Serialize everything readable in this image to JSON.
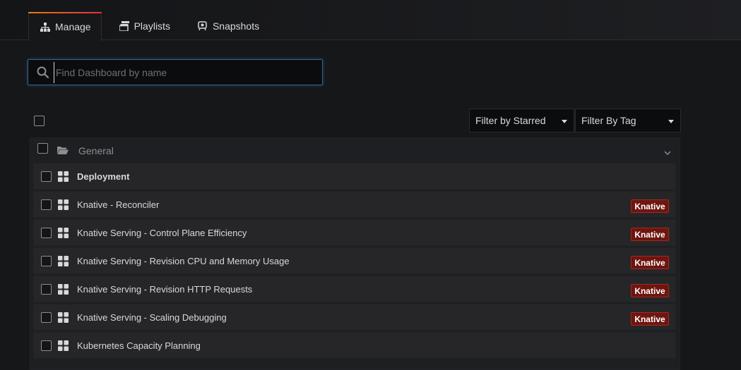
{
  "tabs": [
    {
      "label": "Manage",
      "icon": "sitemap-icon",
      "active": true
    },
    {
      "label": "Playlists",
      "icon": "playlist-icon",
      "active": false
    },
    {
      "label": "Snapshots",
      "icon": "snapshot-icon",
      "active": false
    }
  ],
  "search": {
    "placeholder": "Find Dashboard by name",
    "value": ""
  },
  "filters": {
    "starred_label": "Filter by Starred",
    "tag_label": "Filter By Tag"
  },
  "folder": {
    "title": "General",
    "icon": "folder-open-icon"
  },
  "dashboards": [
    {
      "title": "Deployment",
      "tag": ""
    },
    {
      "title": "Knative - Reconciler",
      "tag": "Knative"
    },
    {
      "title": "Knative Serving - Control Plane Efficiency",
      "tag": "Knative"
    },
    {
      "title": "Knative Serving - Revision CPU and Memory Usage",
      "tag": "Knative"
    },
    {
      "title": "Knative Serving - Revision HTTP Requests",
      "tag": "Knative"
    },
    {
      "title": "Knative Serving - Scaling Debugging",
      "tag": "Knative"
    },
    {
      "title": "Kubernetes Capacity Planning",
      "tag": ""
    }
  ],
  "colors": {
    "accent_start": "#eb7b18",
    "accent_end": "#e02f44",
    "tag_bg": "#6e1510",
    "background": "#161719"
  }
}
